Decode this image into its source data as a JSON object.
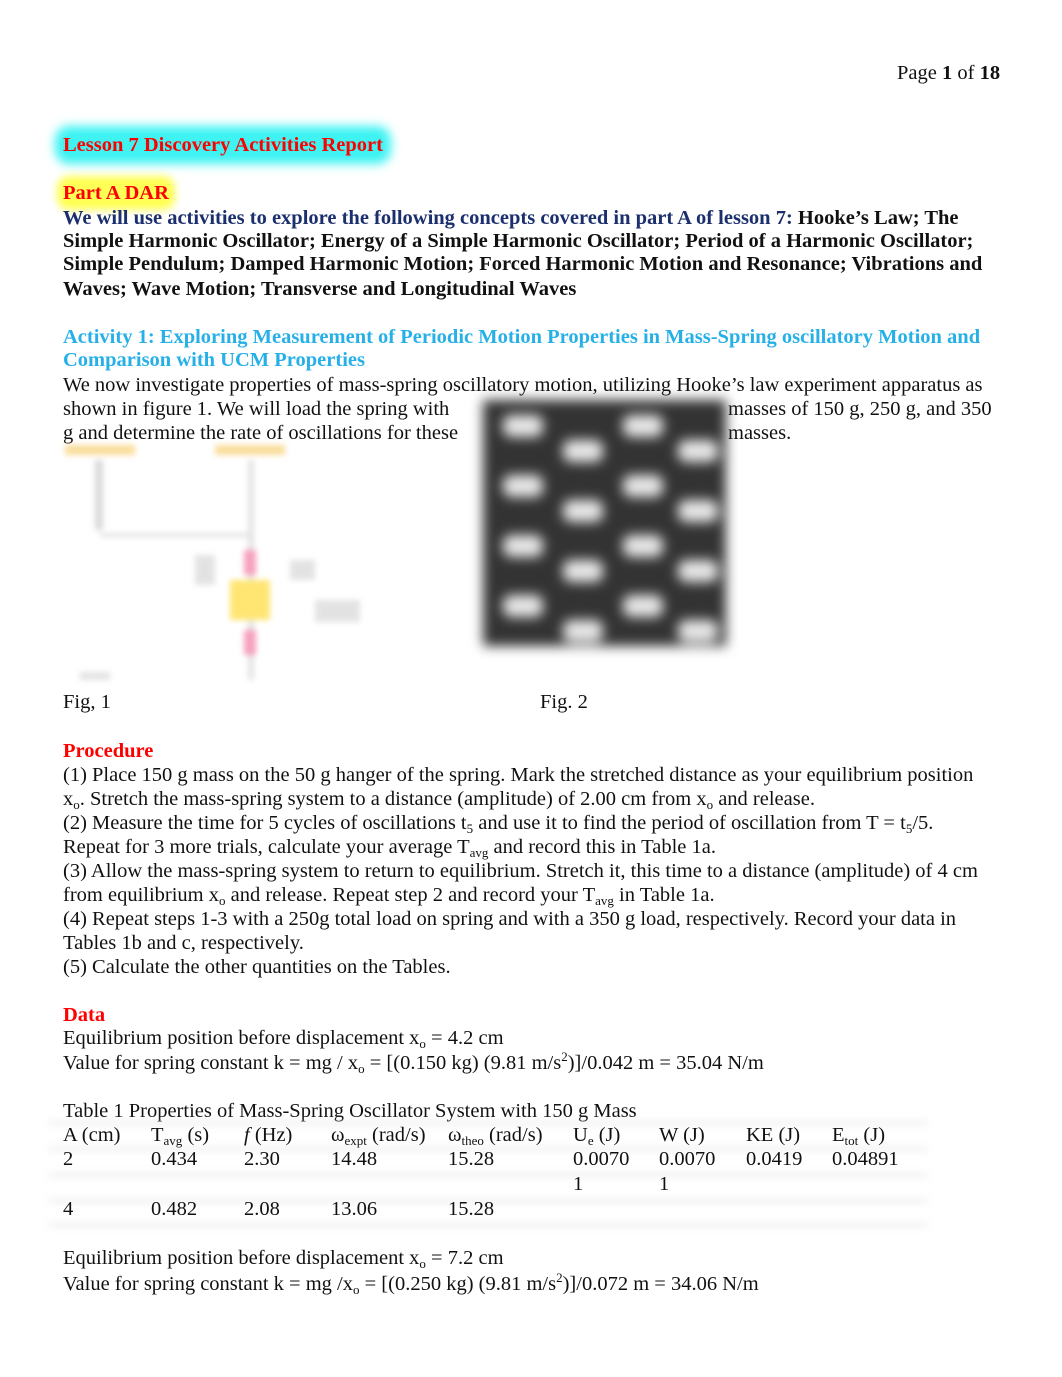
{
  "header": {
    "page": [
      [
        "Page ",
        ""
      ],
      [
        "1",
        "b"
      ],
      [
        " of ",
        ""
      ],
      [
        "18",
        "b"
      ]
    ]
  },
  "lines": {
    "title": [
      [
        "Lesson 7 Discovery Activities Report",
        ""
      ]
    ],
    "parta": [
      [
        "Part A DAR",
        ""
      ]
    ],
    "intro1": [
      [
        "We will use activities to explore the following concepts covered in part A of lesson 7: ",
        "navy"
      ],
      [
        "Hooke’s Law; The",
        "b"
      ]
    ],
    "intro2": [
      [
        "Simple Harmonic Oscillator; Energy of a Simple Harmonic Oscillator; Period of a Harmonic Oscillator;",
        "b"
      ]
    ],
    "intro3": [
      [
        "Simple Pendulum; Damped Harmonic Motion; Forced Harmonic Motion and Resonance; Vibrations and",
        "b"
      ]
    ],
    "intro4": [
      [
        "Waves; Wave Motion; Transverse and Longitudinal Waves",
        "b"
      ]
    ],
    "act1": [
      [
        "Activity 1: Exploring Measurement of Periodic Motion Properties in Mass-Spring oscillatory Motion and",
        ""
      ]
    ],
    "act2": [
      [
        "Comparison with UCM Properties",
        ""
      ]
    ],
    "p1": [
      [
        "We now investigate properties of mass-spring oscillatory motion, utilizing Hooke’s law experiment apparatus as",
        ""
      ]
    ],
    "p2a": [
      [
        "shown in figure 1. We will load the spring with",
        ""
      ]
    ],
    "p2b": [
      [
        "masses of 150 g, 250 g, and 350",
        ""
      ]
    ],
    "p3a": [
      [
        "g and determine the rate of oscillations for these",
        ""
      ]
    ],
    "p3b": [
      [
        "masses.",
        ""
      ]
    ],
    "fig1": [
      [
        "Fig, 1",
        ""
      ]
    ],
    "fig2": [
      [
        "Fig. 2",
        ""
      ]
    ],
    "proc": [
      [
        "Procedure",
        ""
      ]
    ],
    "pr1": [
      [
        "(1) Place 150 g mass on the 50 g hanger of the spring. Mark the stretched distance as your equilibrium position",
        ""
      ]
    ],
    "pr2": [
      [
        "x",
        ""
      ],
      [
        "o",
        "sub"
      ],
      [
        ". Stretch the mass-spring system to a distance (amplitude) of 2.00 cm from x",
        ""
      ],
      [
        "o",
        "sub"
      ],
      [
        " and release.",
        ""
      ]
    ],
    "pr3": [
      [
        "(2) Measure the time for 5 cycles of oscillations t",
        ""
      ],
      [
        "5",
        "sub"
      ],
      [
        " and use it to find the period of oscillation from T = t",
        ""
      ],
      [
        "5",
        "sub"
      ],
      [
        "/5.",
        ""
      ]
    ],
    "pr4": [
      [
        "Repeat for 3 more trials, calculate your average T",
        ""
      ],
      [
        "avg",
        "sub"
      ],
      [
        " and record this in Table 1a.",
        ""
      ]
    ],
    "pr5": [
      [
        "(3) Allow the mass-spring system to return to equilibrium. Stretch it, this time to a distance (amplitude) of 4 cm",
        ""
      ]
    ],
    "pr6": [
      [
        "from equilibrium x",
        ""
      ],
      [
        "o",
        "sub"
      ],
      [
        " and release. Repeat step 2 and record your T",
        ""
      ],
      [
        "avg",
        "sub"
      ],
      [
        " in Table 1a.",
        ""
      ]
    ],
    "pr7": [
      [
        "(4) Repeat steps 1-3 with a 250g total load on spring and with a 350 g load, respectively. Record your data in",
        ""
      ]
    ],
    "pr8": [
      [
        "Tables 1b and c, respectively.",
        ""
      ]
    ],
    "pr9": [
      [
        "(5) Calculate the other quantities on the Tables.",
        ""
      ]
    ],
    "data": [
      [
        "Data",
        ""
      ]
    ],
    "d1": [
      [
        "Equilibrium position before displacement x",
        ""
      ],
      [
        "o",
        "sub"
      ],
      [
        " = 4.2 cm",
        ""
      ]
    ],
    "d2": [
      [
        "Value for spring constant k = mg / x",
        ""
      ],
      [
        "o",
        "sub"
      ],
      [
        " = [(0.150 kg) (9.81 m/s",
        ""
      ],
      [
        "2",
        "sup"
      ],
      [
        ")]/0.042 m = 35.04 N/m",
        ""
      ]
    ],
    "tcap": [
      [
        "Table 1 Properties of Mass-Spring Oscillator System with 150 g Mass",
        ""
      ]
    ],
    "d3": [
      [
        "Equilibrium position before displacement x",
        ""
      ],
      [
        "o",
        "sub"
      ],
      [
        " = 7.2 cm",
        ""
      ]
    ],
    "d4": [
      [
        "Value for spring constant k = mg /x",
        ""
      ],
      [
        "o",
        "sub"
      ],
      [
        " = [(0.250 kg) (9.81 m/s",
        ""
      ],
      [
        "2",
        "sup"
      ],
      [
        ")]/0.072 m = 34.06 N/m",
        ""
      ]
    ]
  },
  "table": {
    "headers": [
      [
        [
          "A (cm)",
          ""
        ]
      ],
      [
        [
          "T",
          ""
        ],
        [
          "avg",
          "sub"
        ],
        [
          " (s)",
          ""
        ]
      ],
      [
        [
          "f",
          "i"
        ],
        [
          " (Hz)",
          ""
        ]
      ],
      [
        [
          "ω",
          ""
        ],
        [
          "expt",
          "sub"
        ],
        [
          " (rad/s)",
          ""
        ]
      ],
      [
        [
          "ω",
          ""
        ],
        [
          "theo",
          "sub"
        ],
        [
          " (rad/s)",
          ""
        ]
      ],
      [
        [
          "U",
          ""
        ],
        [
          "e",
          "sub"
        ],
        [
          " (J)",
          ""
        ]
      ],
      [
        [
          "W (J)",
          ""
        ]
      ],
      [
        [
          "KE (J)",
          ""
        ]
      ],
      [
        [
          "E",
          ""
        ],
        [
          "tot",
          "sub"
        ],
        [
          " (J)",
          ""
        ]
      ]
    ],
    "rows": [
      [
        "2",
        "0.434",
        "2.30",
        "14.48",
        "15.28",
        "0.0070",
        "0.0070",
        "0.0419",
        "0.04891"
      ],
      [
        "",
        "",
        "",
        "",
        "",
        "1",
        "1",
        "",
        ""
      ],
      [
        "4",
        "0.482",
        "2.08",
        "13.06",
        "15.28",
        "",
        "",
        "",
        ""
      ]
    ]
  },
  "colors": {
    "heading_red": "#ff0000",
    "intro_navy": "#1b2f6e",
    "activity_cyan": "#27b0e8",
    "title_highlight": "#3ff3f3",
    "part_highlight": "#ffff55"
  }
}
